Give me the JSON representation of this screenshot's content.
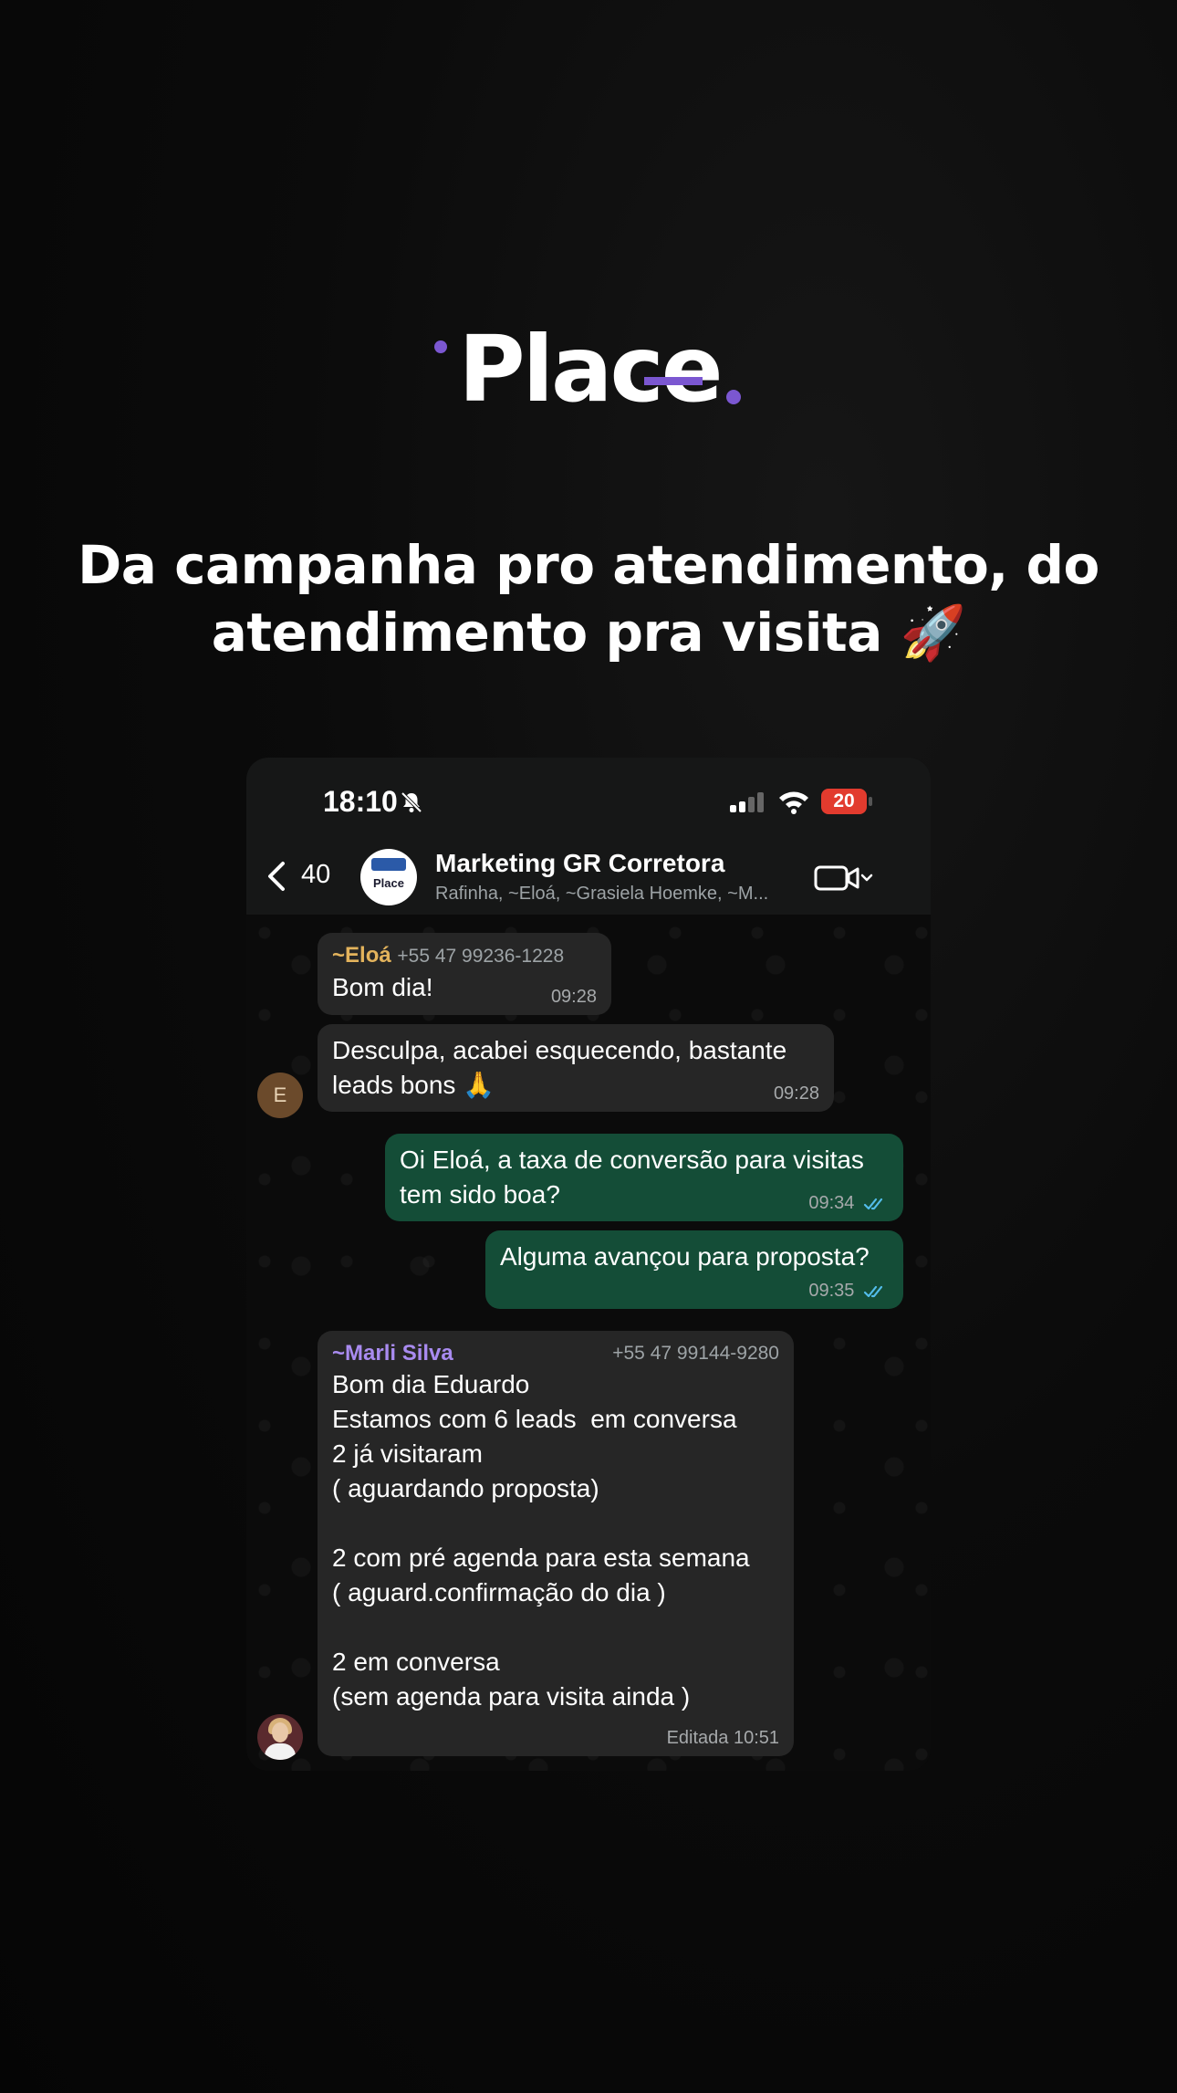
{
  "logo": {
    "text": "Place"
  },
  "headline": {
    "line1": "Da campanha pro atendimento, do",
    "line2": "atendimento pra visita 🚀"
  },
  "status_bar": {
    "time": "18:10",
    "battery": "20"
  },
  "chat_header": {
    "back_count": "40",
    "group_avatar_text": "Place",
    "group_name": "Marketing GR Corretora",
    "members": "Rafinha, ~Eloá, ~Grasiela Hoemke, ~M..."
  },
  "messages": [
    {
      "sender": "~Eloá",
      "sender_phone": "+55 47 99236-1228",
      "text": "Bom dia!",
      "time": "09:28"
    },
    {
      "avatar_letter": "E",
      "line1": "Desculpa, acabei esquecendo, bastante",
      "line2": "leads bons 🙏",
      "time": "09:28"
    },
    {
      "line1": "Oi Eloá, a taxa de conversão para visitas",
      "line2": "tem sido boa?",
      "time": "09:34"
    },
    {
      "text": "Alguma avançou para proposta?",
      "time": "09:35"
    },
    {
      "sender": "~Marli Silva",
      "sender_phone": "+55 47 99144-9280",
      "lines": [
        "Bom dia Eduardo",
        "Estamos com 6 leads  em conversa",
        "2 já visitaram",
        "( aguardando proposta)",
        "",
        "2 com pré agenda para esta semana",
        "( aguard.confirmação do dia )",
        "",
        "2 em conversa",
        "(sem agenda para visita ainda )"
      ],
      "time": "Editada 10:51"
    }
  ],
  "colors": {
    "accent": "#7b57d1",
    "outgoing_bubble": "#144d37",
    "incoming_bubble": "#262626",
    "sender_eloa": "#e3b35c",
    "sender_marli": "#a98bf0",
    "read_ticks": "#53bdeb"
  }
}
